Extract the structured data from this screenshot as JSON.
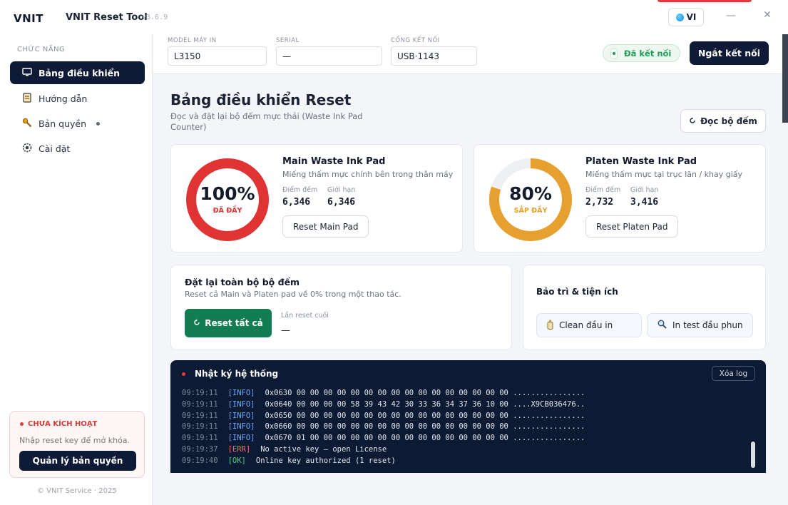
{
  "app": {
    "logo": "VNIT",
    "title": "VNIT Reset Tool",
    "version": "v3.6.9",
    "language": "VI"
  },
  "sidebar": {
    "heading": "CHỨC NĂNG",
    "items": [
      {
        "label": "Bảng điều khiển",
        "icon": "monitor-icon",
        "active": true
      },
      {
        "label": "Hướng dẫn",
        "icon": "book-icon"
      },
      {
        "label": "Bản quyền",
        "icon": "key-icon",
        "badge": true
      },
      {
        "label": "Cài đặt",
        "icon": "gear-icon"
      }
    ],
    "license": {
      "status": "CHƯA KÍCH HOẠT",
      "placeholder": "Nhập reset key để mở khóa.",
      "button": "Quản lý bản quyền"
    },
    "copyright": "© VNIT Service · 2025"
  },
  "connection": {
    "model_label": "MODEL MÁY IN",
    "model": "L3150",
    "serial_label": "SERIAL",
    "serial": "—",
    "port_label": "CỔNG KẾT NỐI",
    "port": "USB·1143",
    "status": "Đã kết nối",
    "disconnect": "Ngắt kết nối"
  },
  "main": {
    "title": "Bảng điều khiển Reset",
    "subtitle": "Đọc và đặt lại bộ đếm mực thải (Waste Ink Pad Counter)",
    "read_button": "Đọc bộ đếm",
    "pads": [
      {
        "title": "Main Waste Ink Pad",
        "desc": "Miếng thấm mực chính bên trong thân máy",
        "percent": 100,
        "percent_text": "100%",
        "state": "ĐÃ ĐẦY",
        "color": "#e03434",
        "counter_label": "Điểm đếm",
        "counter": "6,346",
        "limit_label": "Giới hạn",
        "limit": "6,346",
        "button": "Reset Main Pad"
      },
      {
        "title": "Platen Waste Ink Pad",
        "desc": "Miếng thấm mực tại trục lăn / khay giấy",
        "percent": 80,
        "percent_text": "80%",
        "state": "SẮP ĐẦY",
        "color": "#e5a030",
        "counter_label": "Điểm đếm",
        "counter": "2,732",
        "limit_label": "Giới hạn",
        "limit": "3,416",
        "button": "Reset Platen Pad"
      }
    ],
    "reset_all": {
      "title": "Đặt lại toàn bộ bộ đếm",
      "desc": "Reset cả Main và Platen pad về 0% trong một thao tác.",
      "button": "Reset tất cả",
      "last_label": "Lần reset cuối",
      "last_value": "—"
    },
    "maintenance": {
      "title": "Bảo trì & tiện ích",
      "clean": "Clean đầu in",
      "nozzle": "In test đầu phun"
    }
  },
  "log": {
    "title": "Nhật ký hệ thống",
    "clear": "Xóa log",
    "lines": [
      {
        "time": "09:19:11",
        "level": "[INFO]",
        "kind": "info",
        "msg": "0x0630 00 00 00 00 00 00 00 00 00 00 00 00 00 00 00 00 ................"
      },
      {
        "time": "09:19:11",
        "level": "[INFO]",
        "kind": "info",
        "msg": "0x0640 00 00 00 00 58 39 43 42 30 33 36 34 37 36 10 00 ....X9CB036476.."
      },
      {
        "time": "09:19:11",
        "level": "[INFO]",
        "kind": "info",
        "msg": "0x0650 00 00 00 00 00 00 00 00 00 00 00 00 00 00 00 00 ................"
      },
      {
        "time": "09:19:11",
        "level": "[INFO]",
        "kind": "info",
        "msg": "0x0660 00 00 00 00 00 00 00 00 00 00 00 00 00 00 00 00 ................"
      },
      {
        "time": "09:19:11",
        "level": "[INFO]",
        "kind": "info",
        "msg": "0x0670 01 00 00 00 00 00 00 00 00 00 00 00 00 00 00 00 ................"
      },
      {
        "time": "09:19:37",
        "level": "[ERR]",
        "kind": "err",
        "msg": "No active key — open License"
      },
      {
        "time": "09:19:40",
        "level": "[OK]",
        "kind": "ok",
        "msg": "Online key authorized (1 reset)"
      }
    ]
  }
}
